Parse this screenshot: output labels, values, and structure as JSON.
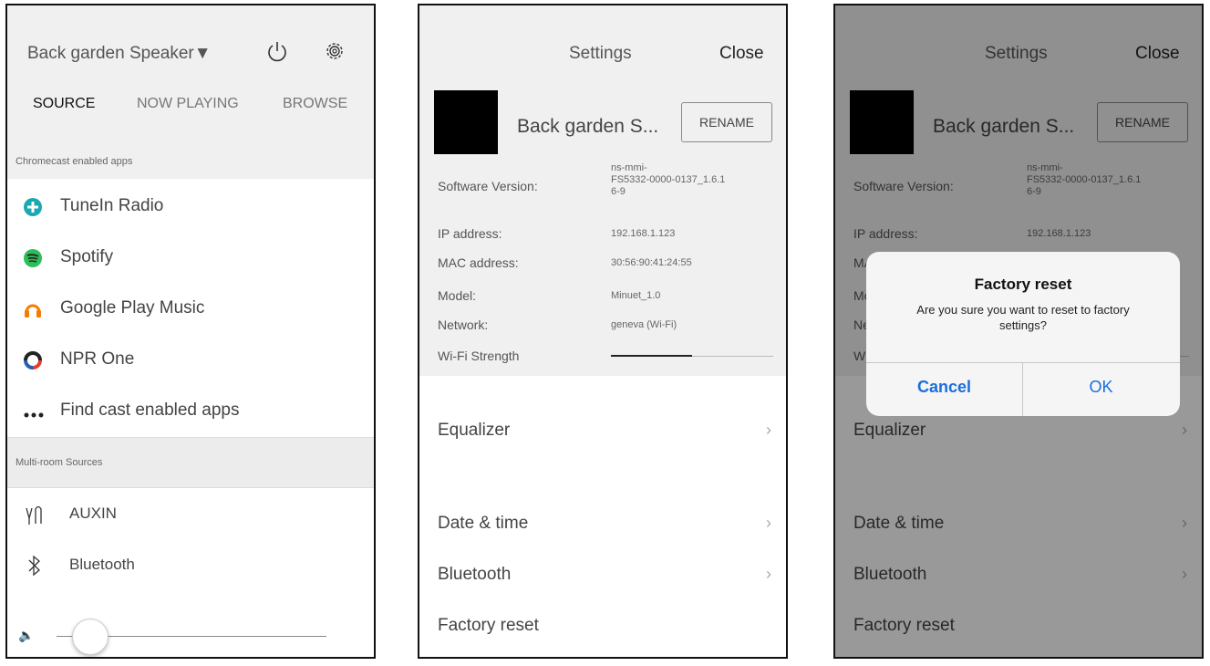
{
  "panel1": {
    "speaker_name": "Back garden Speaker▼",
    "tabs": [
      "SOURCE",
      "NOW PLAYING",
      "BROWSE"
    ],
    "section_chromecast": "Chromecast enabled apps",
    "apps": [
      {
        "label": "TuneIn Radio",
        "icon": "tunein-icon",
        "color": "#1aa9b0"
      },
      {
        "label": "Spotify",
        "icon": "spotify-icon",
        "color": "#2ebd59"
      },
      {
        "label": "Google Play Music",
        "icon": "google-play-music-icon",
        "color": "#f57c00"
      },
      {
        "label": "NPR One",
        "icon": "npr-one-icon",
        "color": "#e63e2d"
      },
      {
        "label": "Find cast enabled apps",
        "icon": "more-dots-icon",
        "color": "#222222"
      }
    ],
    "section_multiroom": "Multi-room Sources",
    "sources": [
      {
        "label": "AUXIN",
        "icon": "aux-cable-icon"
      },
      {
        "label": "Bluetooth",
        "icon": "bluetooth-icon"
      }
    ],
    "volume_level": 0.12
  },
  "settings": {
    "title": "Settings",
    "close": "Close",
    "device_name": "Back garden S...",
    "rename": "RENAME",
    "info": [
      {
        "label": "Software Version:",
        "value": "ns-mmi-\nFS5332-0000-0137_1.6.1\n6-9"
      },
      {
        "label": "IP address:",
        "value": "192.168.1.123"
      },
      {
        "label": "MAC address:",
        "value": "30:56:90:41:24:55"
      },
      {
        "label": "Model:",
        "value": "Minuet_1.0"
      },
      {
        "label": "Network:",
        "value": "geneva (Wi-Fi)"
      }
    ],
    "wifi_label": "Wi-Fi Strength",
    "wifi_strength": 0.5,
    "items": [
      "Equalizer",
      "Date & time",
      "Bluetooth",
      "Factory reset"
    ]
  },
  "dialog": {
    "title": "Factory reset",
    "message": "Are you sure you want to reset to factory settings?",
    "cancel": "Cancel",
    "ok": "OK"
  }
}
